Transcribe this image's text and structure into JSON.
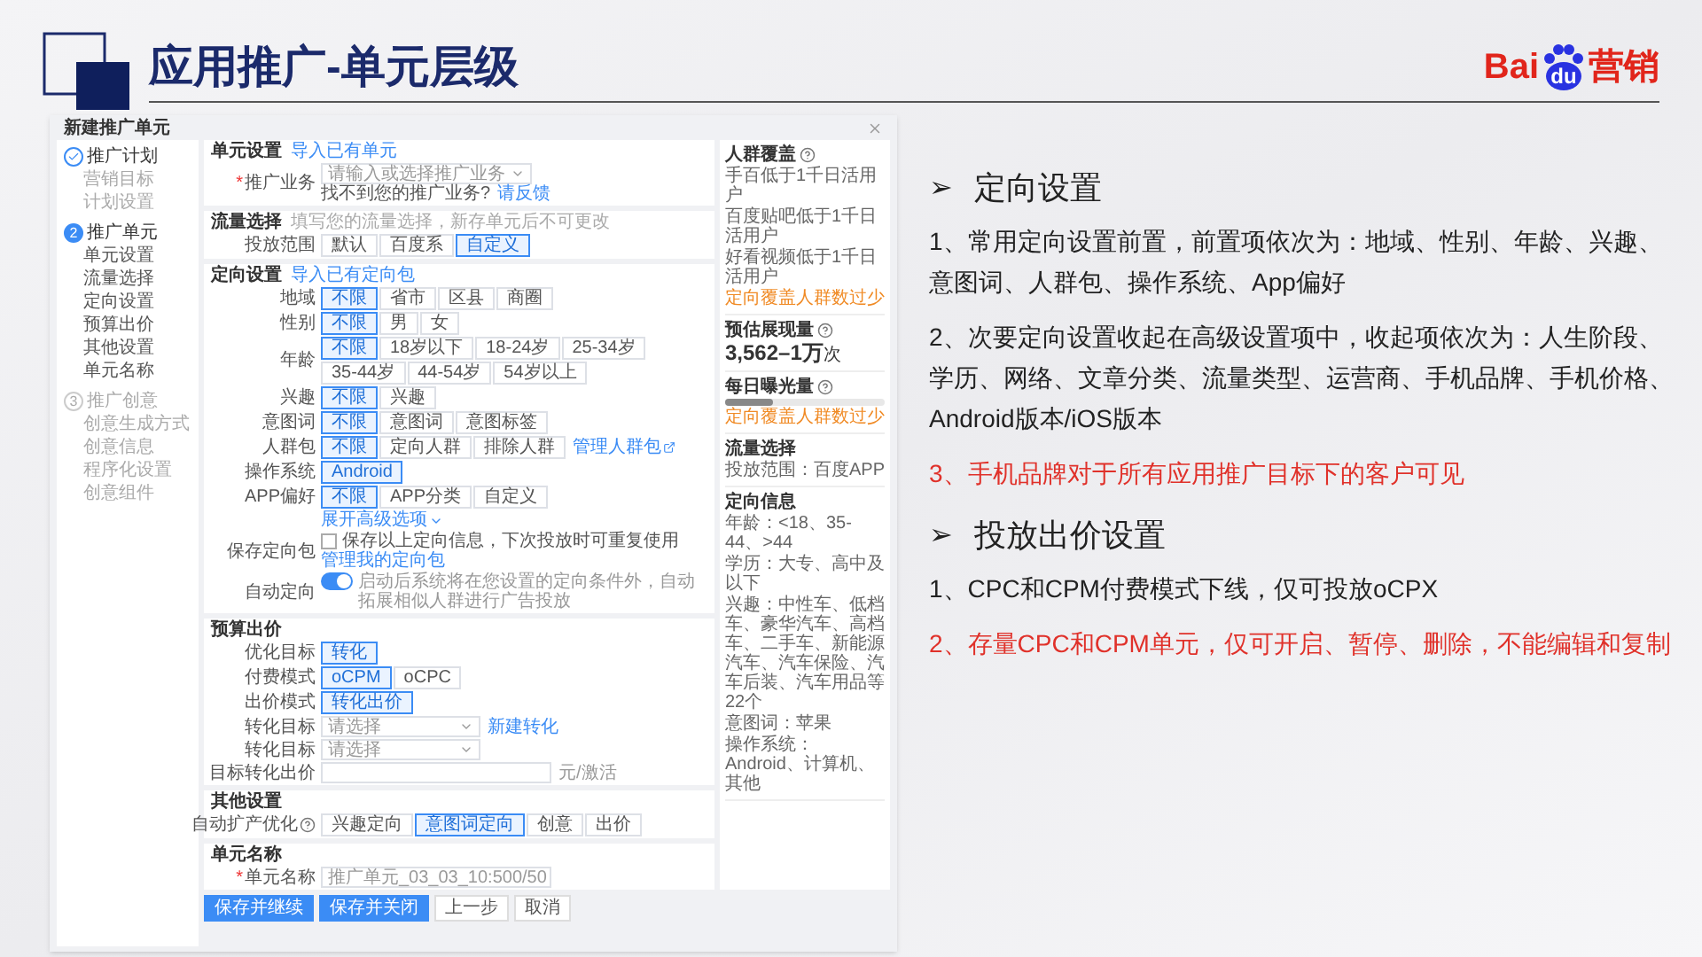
{
  "header": {
    "title": "应用推广-单元层级",
    "logo": {
      "brand_left": "Bai",
      "brand_paw": "du",
      "suffix": "营销"
    }
  },
  "embedded": {
    "window_title": "新建推广单元",
    "steps": [
      {
        "label": "推广计划",
        "done": true,
        "active": false,
        "items": [
          "营销目标",
          "计划设置"
        ]
      },
      {
        "label": "推广单元",
        "done": false,
        "active": true,
        "number": "2",
        "items": [
          "单元设置",
          "流量选择",
          "定向设置",
          "预算出价",
          "其他设置",
          "单元名称"
        ]
      },
      {
        "label": "推广创意",
        "done": false,
        "active": false,
        "number": "3",
        "items": [
          "创意生成方式",
          "创意信息",
          "程序化设置",
          "创意组件"
        ]
      }
    ],
    "sections": [
      {
        "title": "单元设置",
        "link": "导入已有单元",
        "rows": [
          {
            "kind": "select",
            "label": "推广业务",
            "required_mark": "*",
            "placeholder": "请输入或选择推广业务",
            "side_text": "找不到您的推广业务?",
            "side_link": "请反馈"
          }
        ]
      },
      {
        "title": "流量选择",
        "hint": "填写您的流量选择，新存单元后不可更改",
        "rows": [
          {
            "kind": "options",
            "label": "投放范围",
            "options": [
              {
                "label": "默认",
                "selected": false
              },
              {
                "label": "百度系",
                "selected": false
              },
              {
                "label": "自定义",
                "selected": true
              }
            ]
          }
        ]
      },
      {
        "title": "定向设置",
        "link": "导入已有定向包",
        "rows": [
          {
            "kind": "options",
            "label": "地域",
            "options": [
              {
                "label": "不限",
                "selected": true
              },
              {
                "label": "省市",
                "selected": false
              },
              {
                "label": "区县",
                "selected": false
              },
              {
                "label": "商圈",
                "selected": false
              }
            ]
          },
          {
            "kind": "options",
            "label": "性别",
            "options": [
              {
                "label": "不限",
                "selected": true
              },
              {
                "label": "男",
                "selected": false
              },
              {
                "label": "女",
                "selected": false
              }
            ]
          },
          {
            "kind": "options",
            "label": "年龄",
            "options": [
              {
                "label": "不限",
                "selected": true
              },
              {
                "label": "18岁以下",
                "selected": false
              },
              {
                "label": "18-24岁",
                "selected": false
              },
              {
                "label": "25-34岁",
                "selected": false
              },
              {
                "label": "35-44岁",
                "selected": false
              },
              {
                "label": "44-54岁",
                "selected": false
              },
              {
                "label": "54岁以上",
                "selected": false
              }
            ]
          },
          {
            "kind": "options",
            "label": "兴趣",
            "options": [
              {
                "label": "不限",
                "selected": true
              },
              {
                "label": "兴趣",
                "selected": false
              }
            ]
          },
          {
            "kind": "options",
            "label": "意图词",
            "options": [
              {
                "label": "不限",
                "selected": true
              },
              {
                "label": "意图词",
                "selected": false
              },
              {
                "label": "意图标签",
                "selected": false
              }
            ]
          },
          {
            "kind": "options",
            "label": "人群包",
            "options": [
              {
                "label": "不限",
                "selected": true
              },
              {
                "label": "定向人群",
                "selected": false
              },
              {
                "label": "排除人群",
                "selected": false
              }
            ],
            "link": "管理人群包"
          },
          {
            "kind": "options",
            "label": "操作系统",
            "options": [
              {
                "label": "Android",
                "selected": true
              }
            ]
          },
          {
            "kind": "options",
            "label": "APP偏好",
            "options": [
              {
                "label": "不限",
                "selected": true
              },
              {
                "label": "APP分类",
                "selected": false
              },
              {
                "label": "自定义",
                "selected": false
              }
            ]
          },
          {
            "kind": "expand",
            "text": "展开高级选项"
          },
          {
            "kind": "checkbox",
            "label": "保存定向包",
            "checked": false,
            "text": "保存以上定向信息，下次投放时可重复使用",
            "link": "管理我的定向包"
          },
          {
            "kind": "switch",
            "label": "自动定向",
            "on": true,
            "text": "启动后系统将在您设置的定向条件外，自动拓展相似人群进行广告投放"
          }
        ]
      },
      {
        "title": "预算出价",
        "rows": [
          {
            "kind": "options",
            "label": "优化目标",
            "options": [
              {
                "label": "转化",
                "selected": true
              }
            ]
          },
          {
            "kind": "options",
            "label": "付费模式",
            "options": [
              {
                "label": "oCPM",
                "selected": true
              },
              {
                "label": "oCPC",
                "selected": false
              }
            ]
          },
          {
            "kind": "options",
            "label": "出价模式",
            "options": [
              {
                "label": "转化出价",
                "selected": true
              }
            ]
          },
          {
            "kind": "select",
            "label": "转化目标",
            "placeholder": "请选择",
            "side_link": "新建转化"
          },
          {
            "kind": "select",
            "label": "转化目标",
            "placeholder": "请选择"
          },
          {
            "kind": "input",
            "label": "目标转化出价",
            "suffix": "元/激活"
          }
        ]
      },
      {
        "title": "其他设置",
        "rows": [
          {
            "kind": "options",
            "label": "自动扩产优化",
            "help": true,
            "options": [
              {
                "label": "兴趣定向",
                "selected": false
              },
              {
                "label": "意图词定向",
                "selected": true
              },
              {
                "label": "创意",
                "selected": false
              },
              {
                "label": "出价",
                "selected": false
              }
            ]
          }
        ]
      },
      {
        "title": "单元名称",
        "rows": [
          {
            "kind": "input",
            "label": "单元名称",
            "required_mark": "*",
            "placeholder": "推广单元_03_03_10:50",
            "counter": "0/50"
          }
        ]
      }
    ],
    "buttons": [
      {
        "label": "保存并继续",
        "primary": true
      },
      {
        "label": "保存并关闭",
        "primary": true
      },
      {
        "label": "上一步",
        "primary": false
      },
      {
        "label": "取消",
        "primary": false
      }
    ],
    "side_panel": [
      {
        "title": "人群覆盖",
        "help": true,
        "lines": [
          "手百低于1千日活用户",
          "百度贴吧低于1千日活用户",
          "好看视频低于1千日活用户"
        ],
        "warning": "定向覆盖人群数过少"
      },
      {
        "title": "预估展现量",
        "help": true,
        "big_value": "3,562–1万",
        "unit": "次"
      },
      {
        "title": "每日曝光量",
        "help": true,
        "level": 0.3,
        "warning": "定向覆盖人群数过少"
      },
      {
        "title": "流量选择",
        "lines": [
          "投放范围：百度APP"
        ]
      },
      {
        "title": "定向信息",
        "lines": [
          "年龄：<18、35-44、>44",
          "学历：大专、高中及以下",
          "兴趣：中性车、低档车、豪华汽车、高档车、二手车、新能源汽车、汽车保险、汽车后装、汽车用品等22个",
          "意图词：苹果",
          "操作系统：Android、计算机、其他"
        ]
      }
    ]
  },
  "notes": [
    {
      "marker": "➢",
      "heading": "定向设置",
      "items": [
        {
          "text": "1、常用定向设置前置，前置项依次为：地域、性别、年龄、兴趣、意图词、人群包、操作系统、App偏好",
          "color": "#222222"
        },
        {
          "text": "2、次要定向设置收起在高级设置项中，收起项依次为：人生阶段、学历、网络、文章分类、流量类型、运营商、手机品牌、手机价格、Android版本/iOS版本",
          "color": "#222222"
        },
        {
          "text": "3、手机品牌对于所有应用推广目标下的客户可见",
          "color": "#e0312a"
        }
      ]
    },
    {
      "marker": "➢",
      "heading": "投放出价设置",
      "items": [
        {
          "text": "1、CPC和CPM付费模式下线，仅可投放oCPX",
          "color": "#222222"
        },
        {
          "text": "2、存量CPC和CPM单元，仅可开启、暂停、删除，不能编辑和复制",
          "color": "#e0312a"
        }
      ]
    }
  ]
}
